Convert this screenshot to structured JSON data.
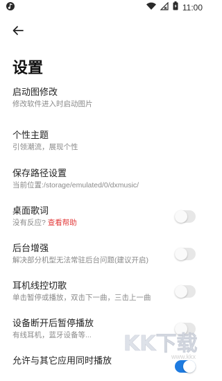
{
  "status_bar": {
    "time": "11:00",
    "left_icon": "music-note-icon",
    "icons": [
      "wifi-icon",
      "signal-blocked-icon",
      "battery-icon"
    ]
  },
  "header": {
    "back_icon": "arrow-left-icon",
    "title": "设置"
  },
  "settings": [
    {
      "title": "启动图修改",
      "subtitle": "修改软件进入时启动图片",
      "has_toggle": false
    },
    {
      "title": "个性主题",
      "subtitle": "引领潮流，展现个性",
      "has_toggle": false
    },
    {
      "title": "保存路径设置",
      "subtitle": "当前位置:/storage/emulated/0/dxmusic/",
      "has_toggle": false
    },
    {
      "title": "桌面歌词",
      "subtitle": "没有反应?",
      "link": "查看帮助",
      "has_toggle": true,
      "toggle_on": false
    },
    {
      "title": "后台增强",
      "subtitle": "解决部分机型无法常驻后台问题(建议开启)",
      "has_toggle": true,
      "toggle_on": false
    },
    {
      "title": "耳机线控切歌",
      "subtitle": "单击暂停或播放，双击下一曲，三击上一曲",
      "has_toggle": true,
      "toggle_on": false
    },
    {
      "title": "设备断开后暂停播放",
      "subtitle": "有线耳机，蓝牙设备等...",
      "has_toggle": true,
      "toggle_on": false
    },
    {
      "title": "允许与其它应用同时播放",
      "subtitle": "",
      "has_toggle": true,
      "toggle_on": true
    }
  ],
  "watermark": {
    "logo": "KK下载",
    "url": "www.kkx"
  },
  "colors": {
    "accent": "#1e7be0",
    "link": "#e23b3b",
    "subtitle": "#8a8a8a"
  }
}
